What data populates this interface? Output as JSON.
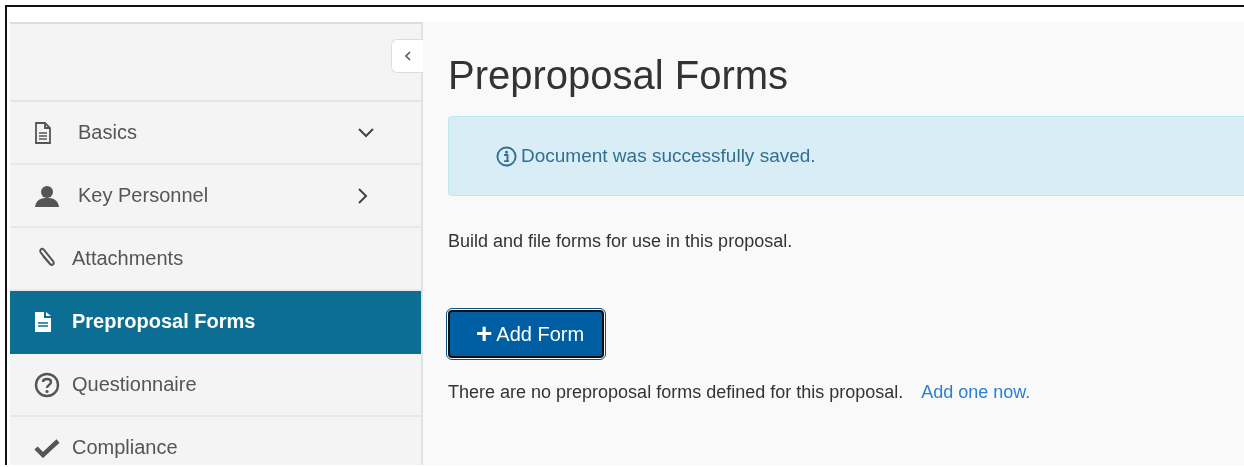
{
  "sidebar": {
    "items": [
      {
        "label": "Basics",
        "kind": "expandable",
        "expanded": true,
        "selected": false
      },
      {
        "label": "Key Personnel",
        "kind": "expandable",
        "expanded": false,
        "selected": false
      },
      {
        "label": "Attachments",
        "kind": "plain",
        "selected": false
      },
      {
        "label": "Preproposal Forms",
        "kind": "plain",
        "selected": true
      },
      {
        "label": "Questionnaire",
        "kind": "plain",
        "selected": false
      },
      {
        "label": "Compliance",
        "kind": "plain",
        "selected": false
      }
    ]
  },
  "page": {
    "title": "Preproposal Forms",
    "alert": {
      "message": "Document was successfully saved."
    },
    "description": "Build and file forms for use in this proposal.",
    "add_button": {
      "icon": "+",
      "label": "Add Form"
    },
    "empty_message": "There are no preproposal forms defined for this proposal.",
    "empty_link": "Add one now."
  }
}
